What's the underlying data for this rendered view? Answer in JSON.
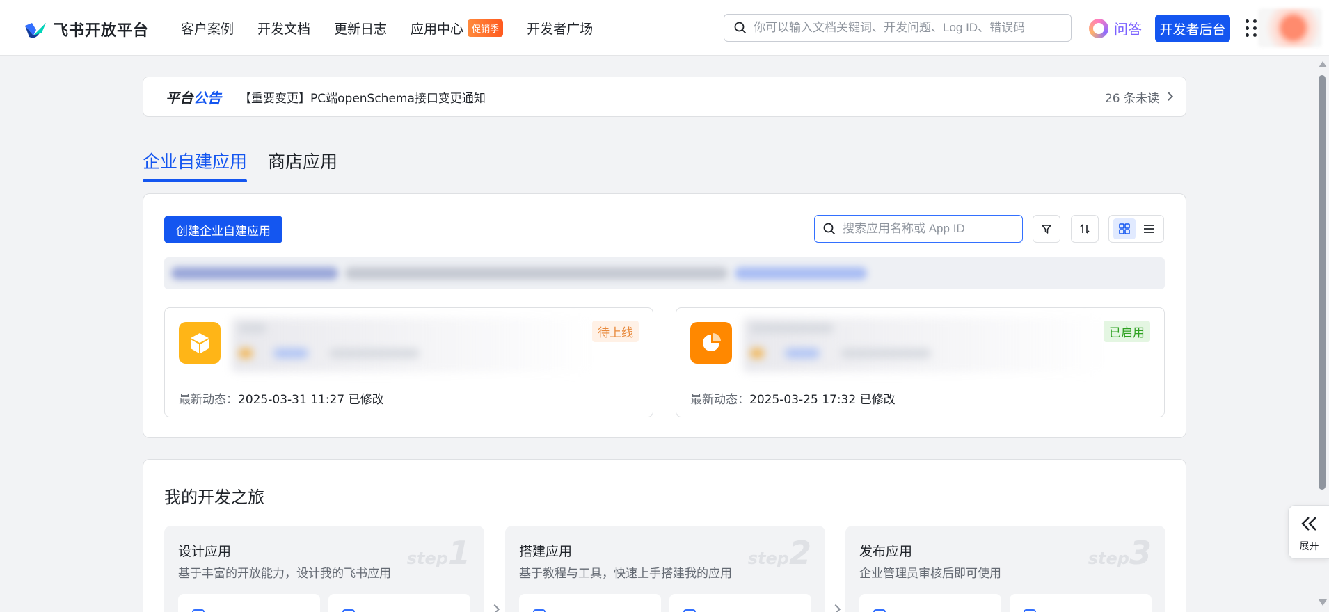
{
  "header": {
    "logo_text": "飞书开放平台",
    "nav": [
      {
        "label": "客户案例"
      },
      {
        "label": "开发文档"
      },
      {
        "label": "更新日志"
      },
      {
        "label": "应用中心",
        "badge": "促销季"
      },
      {
        "label": "开发者广场"
      }
    ],
    "search_placeholder": "你可以输入文档关键词、开发问题、Log ID、错误码",
    "ask_label": "问答",
    "dev_console_label": "开发者后台"
  },
  "announcement": {
    "title_part1": "平台",
    "title_part2": "公告",
    "text": "【重要变更】PC端openSchema接口变更通知",
    "unread": "26 条未读"
  },
  "tabs": [
    {
      "label": "企业自建应用",
      "active": true
    },
    {
      "label": "商店应用",
      "active": false
    }
  ],
  "apps": {
    "create_label": "创建企业自建应用",
    "search_placeholder": "搜索应用名称或 App ID",
    "cards": [
      {
        "status": "待上线",
        "meta_label": "最新动态：",
        "meta_value": "2025-03-31 11:27 已修改",
        "icon": "cube-icon"
      },
      {
        "status": "已启用",
        "meta_label": "最新动态：",
        "meta_value": "2025-03-25 17:32 已修改",
        "icon": "pie-icon"
      }
    ]
  },
  "journey": {
    "title": "我的开发之旅",
    "steps": [
      {
        "title": "设计应用",
        "desc": "基于丰富的开放能力，设计我的飞书应用",
        "step_word": "step",
        "step_num": "1"
      },
      {
        "title": "搭建应用",
        "desc": "基于教程与工具，快速上手搭建我的应用",
        "step_word": "step",
        "step_num": "2"
      },
      {
        "title": "发布应用",
        "desc": "企业管理员审核后即可使用",
        "step_word": "step",
        "step_num": "3"
      }
    ]
  },
  "expand_label": "展开",
  "colors": {
    "brand": "#1456f0",
    "pending": "#e8893b",
    "enabled": "#2ea121"
  }
}
